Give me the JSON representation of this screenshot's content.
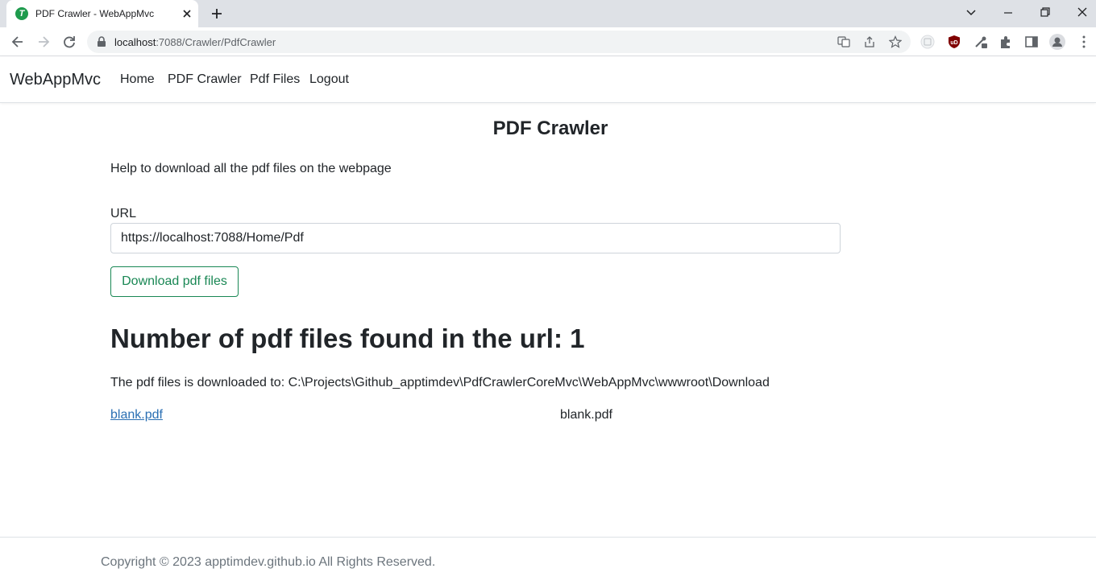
{
  "browser": {
    "tab_title": "PDF Crawler - WebAppMvc",
    "url_host": "localhost",
    "url_rest": ":7088/Crawler/PdfCrawler"
  },
  "site": {
    "brand": "WebAppMvc",
    "nav": [
      "Home",
      "PDF Crawler",
      "Pdf Files",
      "Logout"
    ]
  },
  "main": {
    "title": "PDF Crawler",
    "help": "Help to download all the pdf files on the webpage",
    "url_label": "URL",
    "url_value": "https://localhost:7088/Home/Pdf",
    "download_button": "Download pdf files",
    "count_heading": "Number of pdf files found in the url: 1",
    "download_path": "The pdf files is downloaded to: C:\\Projects\\Github_apptimdev\\PdfCrawlerCoreMvc\\WebAppMvc\\wwwroot\\Download",
    "files": [
      {
        "link": "blank.pdf",
        "name": "blank.pdf"
      }
    ]
  },
  "footer": {
    "copyright": "Copyright © 2023 apptimdev.github.io All Rights Reserved."
  },
  "colors": {
    "accent_green": "#198754",
    "link_blue": "#2a6fb3",
    "chrome_gray": "#dee1e6"
  }
}
